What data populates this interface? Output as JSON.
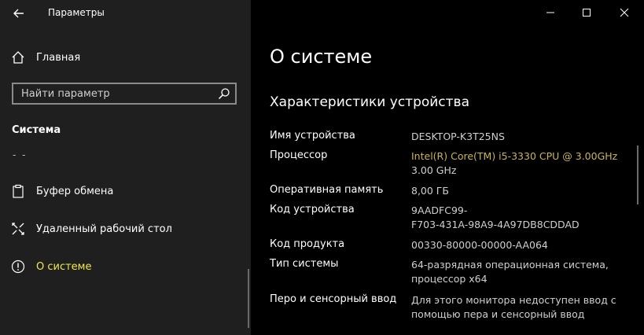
{
  "app": {
    "title": "Параметры"
  },
  "sidebar": {
    "home_label": "Главная",
    "search_placeholder": "Найти параметр",
    "section_title": "Система",
    "partial_item": "- -",
    "items": [
      {
        "label": "Буфер обмена",
        "icon": "clipboard-icon"
      },
      {
        "label": "Удаленный рабочий стол",
        "icon": "remote-desktop-icon"
      },
      {
        "label": "О системе",
        "icon": "info-icon",
        "selected": true
      }
    ]
  },
  "main": {
    "page_title": "О системе",
    "spec_title": "Характеристики устройства",
    "specs": [
      {
        "label": "Имя устройства",
        "value": "DESKTOP-K3T25NS"
      },
      {
        "label": "Процессор",
        "value": "Intel(R) Core(TM) i5-3330 CPU @ 3.00GHz",
        "value2": "3.00 GHz"
      },
      {
        "label": "Оперативная память",
        "value": "8,00 ГБ"
      },
      {
        "label": "Код устройства",
        "value": "9AADFC99-",
        "value2": "F703-431A-98A9-4A97DB8CDDAD"
      },
      {
        "label": "Код продукта",
        "value": "00330-80000-00000-AA064"
      },
      {
        "label": "Тип системы",
        "value": "64-разрядная операционная система,",
        "value2": "процессор x64"
      },
      {
        "label": "Перо и сенсорный ввод",
        "value": "Для этого монитора недоступен ввод с",
        "value2": "помощью пера и сенсорный ввод"
      }
    ]
  },
  "colors": {
    "sidebar_bg": "#1f1f1f",
    "main_bg": "#000000",
    "selected_text": "#f2e84c",
    "accent_value": "#c9b458"
  }
}
